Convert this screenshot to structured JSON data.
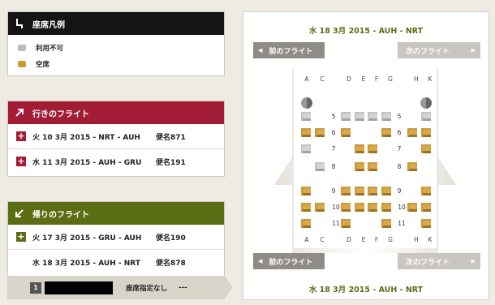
{
  "legend": {
    "title": "座席凡例",
    "items": [
      {
        "label": "利用不可",
        "color": "#bdbdbd"
      },
      {
        "label": "空席",
        "color": "#c99a3a"
      }
    ]
  },
  "outbound": {
    "title": "行きのフライト",
    "color": "#a31c35",
    "flights": [
      {
        "route": "火 10 3月 2015 - NRT - AUH",
        "flight": "便名871"
      },
      {
        "route": "水 11 3月 2015 - AUH - GRU",
        "flight": "便名191"
      }
    ]
  },
  "return": {
    "title": "帰りのフライト",
    "color": "#5b6e14",
    "flights": [
      {
        "route": "火 17 3月 2015 - GRU - AUH",
        "flight": "便名190"
      },
      {
        "route": "水 18 3月 2015 - AUH - NRT",
        "flight": "便名878"
      }
    ],
    "passenger": {
      "index": "1",
      "seat_status": "座席指定なし",
      "seat_value": "---"
    }
  },
  "seatmap": {
    "header_title": "水 18 3月 2015 - AUH - NRT",
    "footer_title": "水 18 3月 2015 - AUH - NRT",
    "prev_label": "前のフライト",
    "next_label": "次のフライト",
    "columns": [
      "A",
      "C",
      "D",
      "E",
      "F",
      "G",
      "H",
      "K"
    ],
    "rows": [
      "5",
      "6",
      "7",
      "8",
      "9",
      "10",
      "11"
    ]
  }
}
